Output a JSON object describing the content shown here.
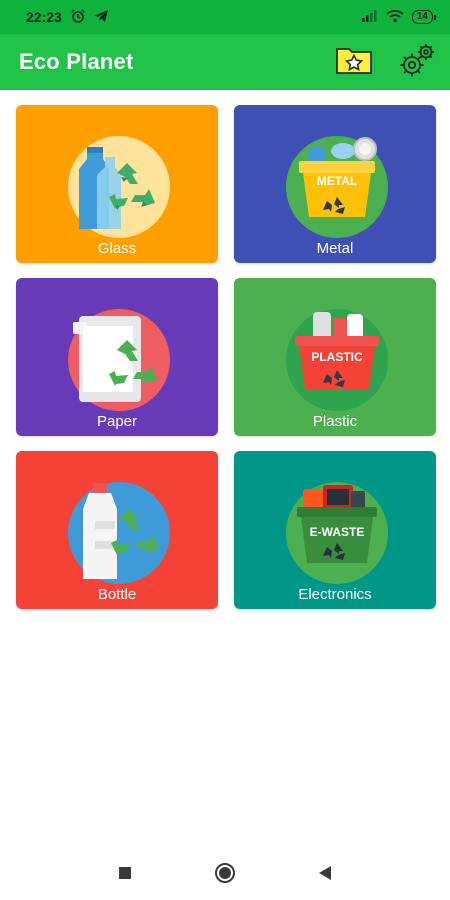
{
  "status_bar": {
    "time": "22:23",
    "battery": "14",
    "icons": [
      "alarm-icon",
      "telegram-icon",
      "signal-icon",
      "wifi-icon",
      "battery-icon"
    ]
  },
  "app_bar": {
    "title": "Eco Planet",
    "actions": [
      "favorites-folder-icon",
      "settings-gear-icon"
    ]
  },
  "categories": [
    {
      "label": "Glass",
      "color": "#ff9f00",
      "icon": "glass-bottle-recycle-icon"
    },
    {
      "label": "Metal",
      "color": "#3f50b5",
      "icon": "metal-bin-icon",
      "badge": "METAL"
    },
    {
      "label": "Paper",
      "color": "#673ab7",
      "icon": "paper-recycle-icon"
    },
    {
      "label": "Plastic",
      "color": "#4caf50",
      "icon": "plastic-bin-icon",
      "badge": "PLASTIC"
    },
    {
      "label": "Bottle",
      "color": "#f44336",
      "icon": "bottle-recycle-icon"
    },
    {
      "label": "Electronics",
      "color": "#009688",
      "icon": "e-waste-bin-icon",
      "badge": "E-WASTE"
    }
  ],
  "nav_bar": [
    "recents-square-icon",
    "home-circle-icon",
    "back-triangle-icon"
  ]
}
